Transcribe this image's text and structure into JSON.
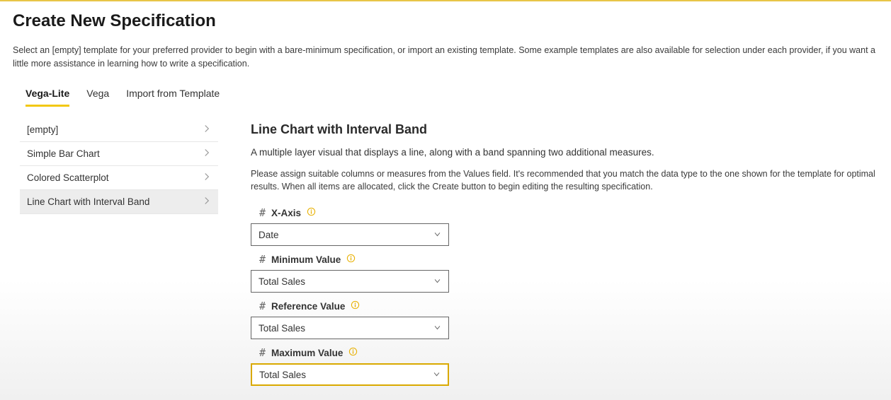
{
  "page": {
    "title": "Create New Specification",
    "description": "Select an [empty] template for your preferred provider to begin with a bare-minimum specification, or import an existing template. Some example templates are also available for selection under each provider, if you want a little more assistance in learning how to write a specification."
  },
  "tabs": [
    {
      "label": "Vega-Lite",
      "active": true
    },
    {
      "label": "Vega",
      "active": false
    },
    {
      "label": "Import from Template",
      "active": false
    }
  ],
  "templates": [
    {
      "label": "[empty]",
      "selected": false
    },
    {
      "label": "Simple Bar Chart",
      "selected": false
    },
    {
      "label": "Colored Scatterplot",
      "selected": false
    },
    {
      "label": "Line Chart with Interval Band",
      "selected": true
    }
  ],
  "detail": {
    "title": "Line Chart with Interval Band",
    "subtitle": "A multiple layer visual that displays a line, along with a band spanning two additional measures.",
    "instructions": "Please assign suitable columns or measures from the Values field. It's recommended that you match the data type to the one shown for the template for optimal results. When all items are allocated, click the Create button to begin editing the resulting specification."
  },
  "fields": [
    {
      "label": "X-Axis",
      "value": "Date",
      "highlight": false
    },
    {
      "label": "Minimum Value",
      "value": "Total Sales",
      "highlight": false
    },
    {
      "label": "Reference Value",
      "value": "Total Sales",
      "highlight": false
    },
    {
      "label": "Maximum Value",
      "value": "Total Sales",
      "highlight": true
    }
  ]
}
